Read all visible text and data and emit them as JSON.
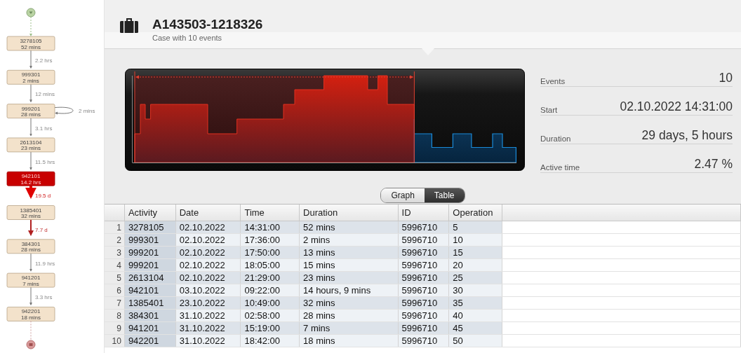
{
  "process_map": {
    "nodes": [
      {
        "activity": "3278105",
        "duration": "52 mins",
        "highlighted": false
      },
      {
        "activity": "999301",
        "duration": "2 mins",
        "highlighted": false
      },
      {
        "activity": "999201",
        "duration": "28 mins",
        "highlighted": false,
        "loop": "2 mins"
      },
      {
        "activity": "2613104",
        "duration": "23 mins",
        "highlighted": false
      },
      {
        "activity": "942101",
        "duration": "14.2 hrs",
        "highlighted": true
      },
      {
        "activity": "1385401",
        "duration": "32 mins",
        "highlighted": false
      },
      {
        "activity": "384301",
        "duration": "28 mins",
        "highlighted": false
      },
      {
        "activity": "941201",
        "duration": "7 mins",
        "highlighted": false
      },
      {
        "activity": "942201",
        "duration": "18 mins",
        "highlighted": false
      }
    ],
    "edges": [
      {
        "label": "2.2 hrs",
        "kind": "normal"
      },
      {
        "label": "12 mins",
        "kind": "normal"
      },
      {
        "label": "3.1 hrs",
        "kind": "normal"
      },
      {
        "label": "11.5 hrs",
        "kind": "normal"
      },
      {
        "label": "19.5 d",
        "kind": "critical"
      },
      {
        "label": "7.7 d",
        "kind": "slow"
      },
      {
        "label": "11.9 hrs",
        "kind": "normal"
      },
      {
        "label": "3.3 hrs",
        "kind": "normal"
      }
    ]
  },
  "case": {
    "title": "A143503-1218326",
    "subtitle": "Case with 10 events"
  },
  "stats": [
    {
      "label": "Events",
      "value": "10"
    },
    {
      "label": "Start",
      "value": "02.10.2022 14:31:00"
    },
    {
      "label": "Duration",
      "value": "29 days, 5 hours"
    },
    {
      "label": "Active time",
      "value": "2.47 %"
    }
  ],
  "view_toggle": [
    {
      "label": "Graph",
      "selected": false
    },
    {
      "label": "Table",
      "selected": true
    }
  ],
  "table": {
    "columns": [
      "Activity",
      "Date",
      "Time",
      "Duration",
      "ID",
      "Operation"
    ],
    "rows": [
      {
        "num": "1",
        "cells": [
          "3278105",
          "02.10.2022",
          "14:31:00",
          "52 mins",
          "5996710",
          "5"
        ]
      },
      {
        "num": "2",
        "cells": [
          "999301",
          "02.10.2022",
          "17:36:00",
          "2 mins",
          "5996710",
          "10"
        ]
      },
      {
        "num": "3",
        "cells": [
          "999201",
          "02.10.2022",
          "17:50:00",
          "13 mins",
          "5996710",
          "15"
        ]
      },
      {
        "num": "4",
        "cells": [
          "999201",
          "02.10.2022",
          "18:05:00",
          "15 mins",
          "5996710",
          "20"
        ]
      },
      {
        "num": "5",
        "cells": [
          "2613104",
          "02.10.2022",
          "21:29:00",
          "23 mins",
          "5996710",
          "25"
        ]
      },
      {
        "num": "6",
        "cells": [
          "942101",
          "03.10.2022",
          "09:22:00",
          "14 hours, 9 mins",
          "5996710",
          "30"
        ]
      },
      {
        "num": "7",
        "cells": [
          "1385401",
          "23.10.2022",
          "10:49:00",
          "32 mins",
          "5996710",
          "35"
        ]
      },
      {
        "num": "8",
        "cells": [
          "384301",
          "31.10.2022",
          "02:58:00",
          "28 mins",
          "5996710",
          "40"
        ]
      },
      {
        "num": "9",
        "cells": [
          "941201",
          "31.10.2022",
          "15:19:00",
          "7 mins",
          "5996710",
          "45"
        ]
      },
      {
        "num": "10",
        "cells": [
          "942201",
          "31.10.2022",
          "18:42:00",
          "18 mins",
          "5996710",
          "50"
        ]
      }
    ]
  }
}
